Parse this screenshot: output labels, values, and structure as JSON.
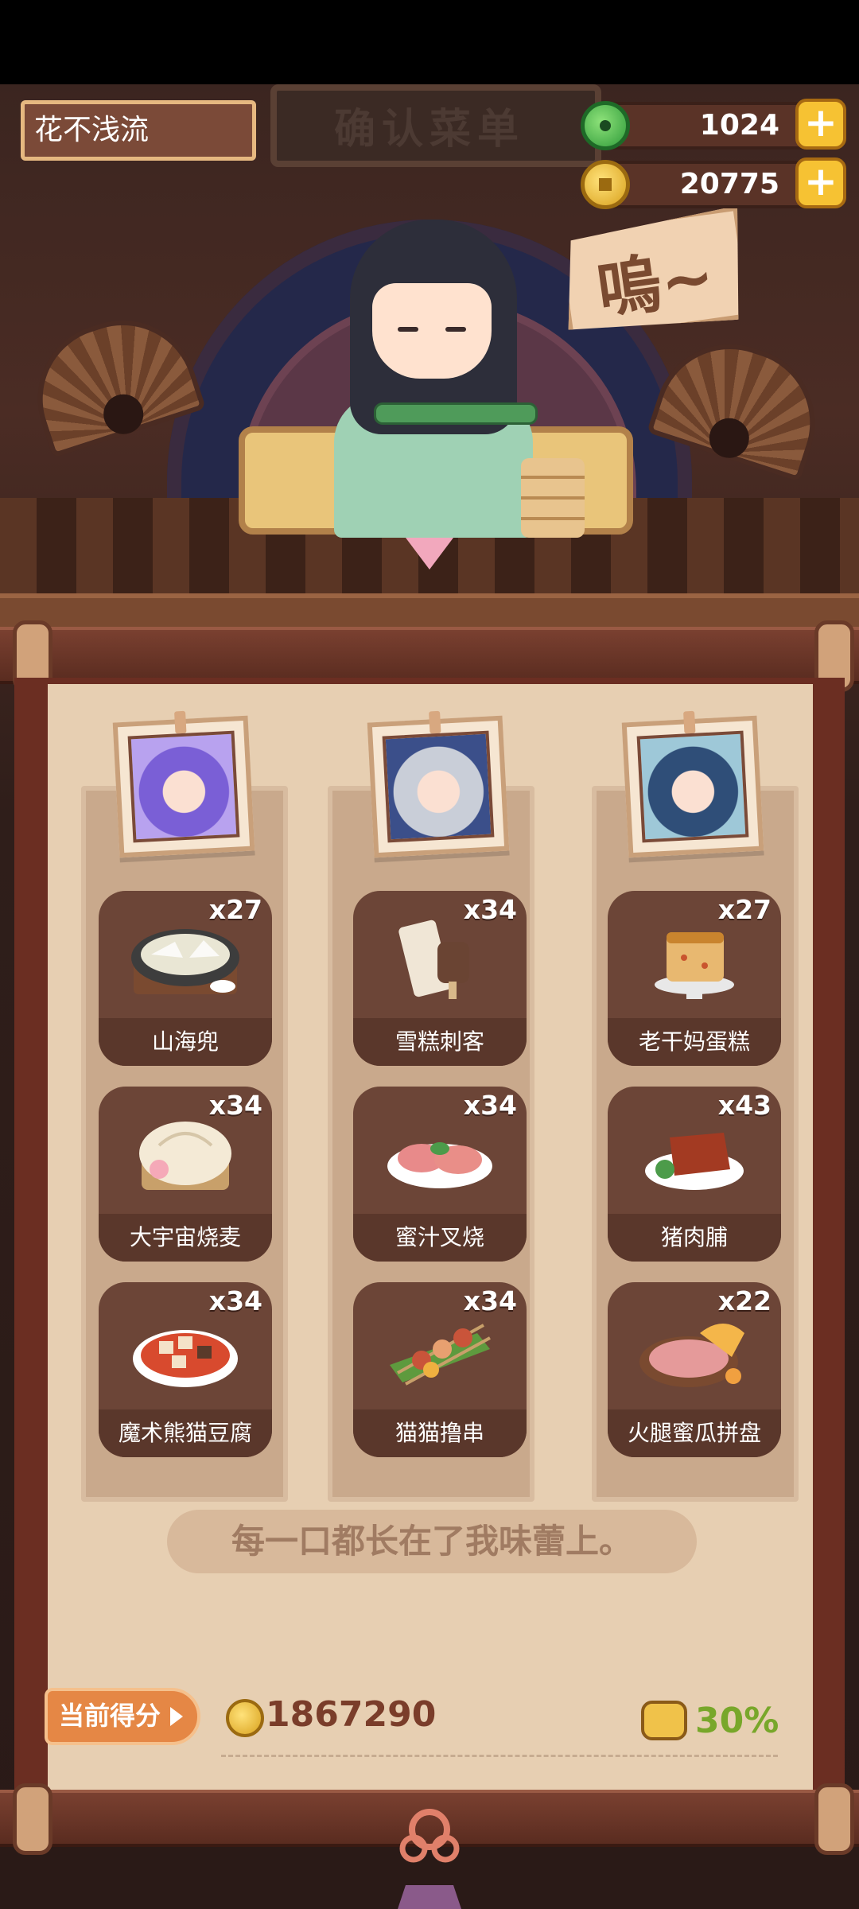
{
  "player": {
    "name": "花不浅流"
  },
  "currencies": [
    {
      "icon": "jade-icon",
      "value": "1024"
    },
    {
      "icon": "gold-coin-icon",
      "value": "20775"
    }
  ],
  "header_sign": "确认菜单",
  "speech_sign": "嗚~",
  "columns": [
    {
      "character": "purple-hair-character",
      "dishes": [
        {
          "name": "山海兜",
          "count": "x27"
        },
        {
          "name": "大宇宙烧麦",
          "count": "x34"
        },
        {
          "name": "魔术熊猫豆腐",
          "count": "x34"
        }
      ]
    },
    {
      "character": "silver-hair-character",
      "dishes": [
        {
          "name": "雪糕刺客",
          "count": "x34"
        },
        {
          "name": "蜜汁叉烧",
          "count": "x34"
        },
        {
          "name": "猫猫撸串",
          "count": "x34"
        }
      ]
    },
    {
      "character": "blue-hair-character",
      "dishes": [
        {
          "name": "老干妈蛋糕",
          "count": "x27"
        },
        {
          "name": "猪肉脯",
          "count": "x43"
        },
        {
          "name": "火腿蜜瓜拼盘",
          "count": "x22"
        }
      ]
    }
  ],
  "quote": "每一口都长在了我味蕾上。",
  "score": {
    "label": "当前得分",
    "value": "1867290"
  },
  "bonus": {
    "value": "30%"
  },
  "colors": {
    "accent": "#e58745",
    "bonus_green": "#78a72a",
    "card_brown": "#6c4537"
  }
}
